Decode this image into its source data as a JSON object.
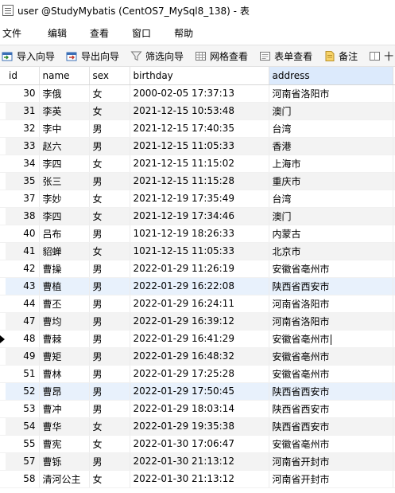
{
  "window": {
    "title": "user @StudyMybatis (CentOS7_MySql8_138) - 表"
  },
  "menu": [
    "文件",
    "编辑",
    "查看",
    "窗口",
    "帮助"
  ],
  "toolbar": {
    "import_wizard": "导入向导",
    "export_wizard": "导出向导",
    "filter_wizard": "筛选向导",
    "grid_view": "网格查看",
    "form_view": "表单查看",
    "memo": "备注",
    "hex": "十"
  },
  "table": {
    "columns": [
      "id",
      "name",
      "sex",
      "birthday",
      "address"
    ],
    "sorted_column": "address",
    "current_row_id": "48",
    "rows": [
      [
        "30",
        "李俄",
        "女",
        "2000-02-05 17:37:13",
        "河南省洛阳市"
      ],
      [
        "31",
        "李英",
        "女",
        "2021-12-15 10:53:48",
        "澳门"
      ],
      [
        "32",
        "李中",
        "男",
        "2021-12-15 17:40:35",
        "台湾"
      ],
      [
        "33",
        "赵六",
        "男",
        "2021-12-15 11:05:33",
        "香港"
      ],
      [
        "34",
        "李四",
        "女",
        "2021-12-15 11:15:02",
        "上海市"
      ],
      [
        "35",
        "张三",
        "男",
        "2021-12-15 11:15:28",
        "重庆市"
      ],
      [
        "37",
        "李妙",
        "女",
        "2021-12-19 17:35:49",
        "台湾"
      ],
      [
        "38",
        "李四",
        "女",
        "2021-12-19 17:34:46",
        "澳门"
      ],
      [
        "40",
        "吕布",
        "男",
        "1021-12-19 18:26:33",
        "内蒙古"
      ],
      [
        "41",
        "貂蝉",
        "女",
        "1021-12-15 11:05:33",
        "北京市"
      ],
      [
        "42",
        "曹操",
        "男",
        "2022-01-29 11:26:19",
        "安徽省亳州市"
      ],
      [
        "43",
        "曹植",
        "男",
        "2022-01-29 16:22:08",
        "陕西省西安市"
      ],
      [
        "44",
        "曹丕",
        "男",
        "2022-01-29 16:24:11",
        "河南省洛阳市"
      ],
      [
        "47",
        "曹均",
        "男",
        "2022-01-29 16:39:12",
        "河南省洛阳市"
      ],
      [
        "48",
        "曹棘",
        "男",
        "2022-01-29 16:41:29",
        "安徽省亳州市"
      ],
      [
        "49",
        "曹矩",
        "男",
        "2022-01-29 16:48:32",
        "安徽省亳州市"
      ],
      [
        "51",
        "曹林",
        "男",
        "2022-01-29 17:25:28",
        "安徽省亳州市"
      ],
      [
        "52",
        "曹昂",
        "男",
        "2022-01-29 17:50:45",
        "陕西省西安市"
      ],
      [
        "53",
        "曹冲",
        "男",
        "2022-01-29 18:03:14",
        "陕西省西安市"
      ],
      [
        "54",
        "曹华",
        "女",
        "2022-01-29 19:35:38",
        "陕西省西安市"
      ],
      [
        "55",
        "曹宪",
        "女",
        "2022-01-30 17:06:47",
        "安徽省亳州市"
      ],
      [
        "57",
        "曹铄",
        "男",
        "2022-01-30 21:13:12",
        "河南省开封市"
      ],
      [
        "58",
        "清河公主",
        "女",
        "2022-01-30 21:13:12",
        "河南省开封市"
      ]
    ]
  }
}
